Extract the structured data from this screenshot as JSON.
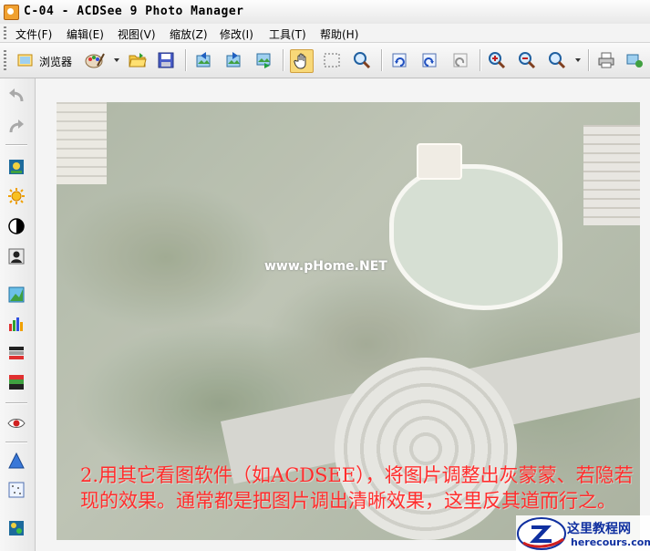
{
  "window": {
    "title": "C-04 - ACDSee 9 Photo Manager"
  },
  "menu": [
    {
      "label": "文件(F)"
    },
    {
      "label": "编辑(E)"
    },
    {
      "label": "视图(V)"
    },
    {
      "label": "缩放(Z)"
    },
    {
      "label": "修改(I)"
    },
    {
      "label": "工具(T)"
    },
    {
      "label": "帮助(H)"
    }
  ],
  "toolbar": {
    "browser_label": "浏览器"
  },
  "viewer": {
    "watermark": "www.pHome.NET",
    "caption": "2.用其它看图软件（如ACDSEE），将图片调整出灰蒙蒙、若隐若现的效果。通常都是把图片调出清晰效果，这里反其道而行之。"
  },
  "site": {
    "name": "这里教程网",
    "url": "herecours.com"
  }
}
